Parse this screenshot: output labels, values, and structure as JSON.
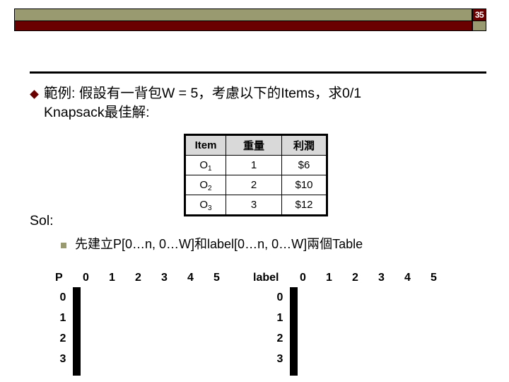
{
  "slide": {
    "page_number": "35",
    "banner_olive_color": "#9a9a70",
    "banner_maroon_color": "#6b0000"
  },
  "bullet1": {
    "marker": "diamond-bullet",
    "text": "範例: 假設有一背包W = 5，考慮以下的Items，求0/1\nKnapsack最佳解:"
  },
  "item_table": {
    "headers": [
      "Item",
      "重量",
      "利潤"
    ],
    "rows": [
      {
        "item_base": "O",
        "item_sub": "1",
        "weight": "1",
        "profit": "$6"
      },
      {
        "item_base": "O",
        "item_sub": "2",
        "weight": "2",
        "profit": "$10"
      },
      {
        "item_base": "O",
        "item_sub": "3",
        "weight": "3",
        "profit": "$12"
      }
    ]
  },
  "sol": {
    "label": "Sol:"
  },
  "bullet2": {
    "marker": "square-bullet",
    "text": "先建立P[0…n, 0…W]和label[0…n, 0…W]兩個Table"
  },
  "grids": [
    {
      "name": "P",
      "corner_label": "P",
      "column_headers": [
        "0",
        "1",
        "2",
        "3",
        "4",
        "5"
      ],
      "row_headers": [
        "0",
        "1",
        "2",
        "3"
      ],
      "cells": [
        [
          "",
          "",
          "",
          "",
          "",
          ""
        ],
        [
          "",
          "",
          "",
          "",
          "",
          ""
        ],
        [
          "",
          "",
          "",
          "",
          "",
          ""
        ],
        [
          "",
          "",
          "",
          "",
          "",
          ""
        ]
      ]
    },
    {
      "name": "label",
      "corner_label": "label",
      "column_headers": [
        "0",
        "1",
        "2",
        "3",
        "4",
        "5"
      ],
      "row_headers": [
        "0",
        "1",
        "2",
        "3"
      ],
      "cells": [
        [
          "",
          "",
          "",
          "",
          "",
          ""
        ],
        [
          "",
          "",
          "",
          "",
          "",
          ""
        ],
        [
          "",
          "",
          "",
          "",
          "",
          ""
        ],
        [
          "",
          "",
          "",
          "",
          "",
          ""
        ]
      ]
    }
  ]
}
